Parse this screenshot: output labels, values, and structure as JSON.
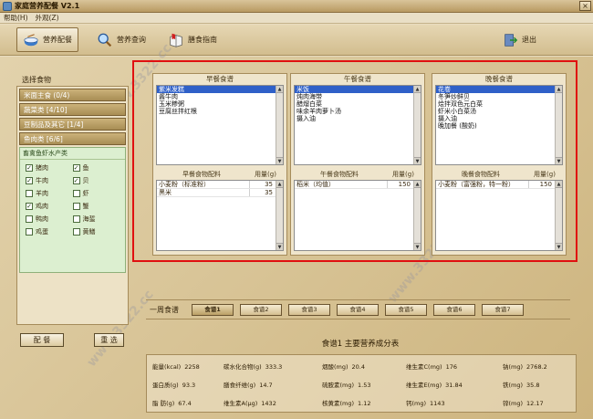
{
  "window": {
    "title": "家庭营养配餐 V2.1",
    "close_glyph": "×"
  },
  "menubar": [
    "帮助(H)",
    "外观(Z)"
  ],
  "toolbar": {
    "nutrition_config": "营养配餐",
    "nutrition_query": "营养查询",
    "diet_guide": "膳食指南",
    "exit": "退出"
  },
  "left": {
    "heading": "选择食物",
    "categories": [
      "米面主食 (0/4)",
      "蔬菜类 [4/10]",
      "豆制品及其它 [1/4]",
      "鱼肉类 [6/6]"
    ],
    "sub_title": "畜禽鱼虾水产类",
    "meats": [
      {
        "name": "猪肉",
        "checked": "✓"
      },
      {
        "name": "鱼",
        "checked": "✓"
      },
      {
        "name": "牛肉",
        "checked": "✓"
      },
      {
        "name": "贝",
        "checked": "✓"
      },
      {
        "name": "羊肉",
        "checked": ""
      },
      {
        "name": "虾",
        "checked": ""
      },
      {
        "name": "鸡肉",
        "checked": "✓"
      },
      {
        "name": "蟹",
        "checked": ""
      },
      {
        "name": "鸭肉",
        "checked": ""
      },
      {
        "name": "海蜇",
        "checked": ""
      },
      {
        "name": "鸡蛋",
        "checked": ""
      },
      {
        "name": "黄鳝",
        "checked": ""
      }
    ],
    "config_btn": "配 餐",
    "reselect_btn": "重 选"
  },
  "breakfast": {
    "title": "早餐食谱",
    "items": [
      "紫米发糕",
      "酱牛肉",
      "玉米糁粥",
      "豆腐丝拌红根"
    ],
    "ing_title": "早餐食物配料",
    "qty_title": "用量(g)",
    "ingredients": [
      {
        "name": "小麦粉（标准粉）",
        "qty": "35"
      },
      {
        "name": "黑米",
        "qty": "35"
      }
    ]
  },
  "lunch": {
    "title": "午餐食谱",
    "items": [
      "米饭",
      "炖肉海带",
      "醋熘白菜",
      "味余羊肉萝卜汤",
      "摄入油"
    ],
    "ing_title": "午餐食物配料",
    "qty_title": "用量(g)",
    "ingredients": [
      {
        "name": "稻米（均值）",
        "qty": "150"
      }
    ]
  },
  "dinner": {
    "title": "晚餐食谱",
    "items": [
      "花卷",
      "冬笋炒鲜贝",
      "烩拌双色元白菜",
      "虾米小白菜汤",
      "摄入油",
      "晚加餐 (酸奶)"
    ],
    "ing_title": "晚餐食物配料",
    "qty_title": "用量(g)",
    "ingredients": [
      {
        "name": "小麦粉（富强粉，特一粉）",
        "qty": "150"
      }
    ]
  },
  "week": {
    "label": "一周食谱",
    "tabs": [
      "食谱1",
      "食谱2",
      "食谱3",
      "食谱4",
      "食谱5",
      "食谱6",
      "食谱7"
    ]
  },
  "nutrition": {
    "title": "食谱1 主要营养成分表",
    "rows": [
      [
        {
          "label": "能量(kcal)",
          "value": "2258"
        },
        {
          "label": "碳水化合物(g)",
          "value": "333.3"
        },
        {
          "label": "烟酸(mg)",
          "value": "20.4"
        },
        {
          "label": "维生素C(mg)",
          "value": "176"
        },
        {
          "label": "钠(mg)",
          "value": "2768.2"
        }
      ],
      [
        {
          "label": "蛋白质(g)",
          "value": "93.3"
        },
        {
          "label": "膳食纤维(g)",
          "value": "14.7"
        },
        {
          "label": "硫胺素(mg)",
          "value": "1.53"
        },
        {
          "label": "维生素E(mg)",
          "value": "31.84"
        },
        {
          "label": "铁(mg)",
          "value": "35.8"
        }
      ],
      [
        {
          "label": "脂 肪(g)",
          "value": "67.4"
        },
        {
          "label": "维生素A(μg)",
          "value": "1432"
        },
        {
          "label": "核黄素(mg)",
          "value": "1.12"
        },
        {
          "label": "钙(mg)",
          "value": "1143"
        },
        {
          "label": "锌(mg)",
          "value": "12.17"
        }
      ]
    ]
  }
}
